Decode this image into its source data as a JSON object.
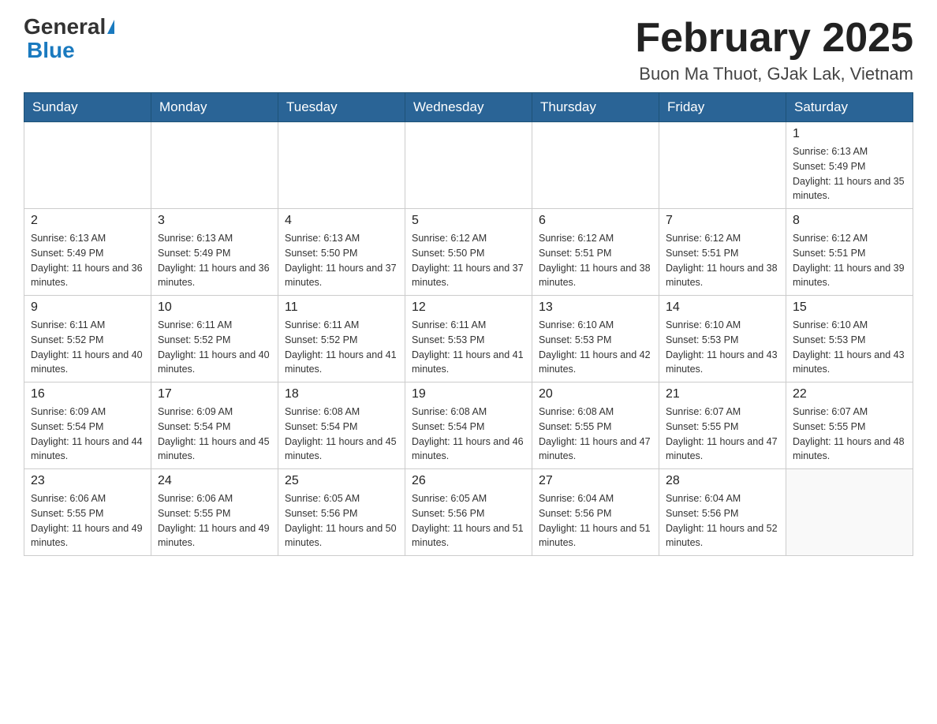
{
  "header": {
    "logo_general": "General",
    "logo_blue": "Blue",
    "month_title": "February 2025",
    "location": "Buon Ma Thuot, GJak Lak, Vietnam"
  },
  "weekdays": [
    "Sunday",
    "Monday",
    "Tuesday",
    "Wednesday",
    "Thursday",
    "Friday",
    "Saturday"
  ],
  "weeks": [
    {
      "days": [
        {
          "number": "",
          "info": ""
        },
        {
          "number": "",
          "info": ""
        },
        {
          "number": "",
          "info": ""
        },
        {
          "number": "",
          "info": ""
        },
        {
          "number": "",
          "info": ""
        },
        {
          "number": "",
          "info": ""
        },
        {
          "number": "1",
          "info": "Sunrise: 6:13 AM\nSunset: 5:49 PM\nDaylight: 11 hours and 35 minutes."
        }
      ]
    },
    {
      "days": [
        {
          "number": "2",
          "info": "Sunrise: 6:13 AM\nSunset: 5:49 PM\nDaylight: 11 hours and 36 minutes."
        },
        {
          "number": "3",
          "info": "Sunrise: 6:13 AM\nSunset: 5:49 PM\nDaylight: 11 hours and 36 minutes."
        },
        {
          "number": "4",
          "info": "Sunrise: 6:13 AM\nSunset: 5:50 PM\nDaylight: 11 hours and 37 minutes."
        },
        {
          "number": "5",
          "info": "Sunrise: 6:12 AM\nSunset: 5:50 PM\nDaylight: 11 hours and 37 minutes."
        },
        {
          "number": "6",
          "info": "Sunrise: 6:12 AM\nSunset: 5:51 PM\nDaylight: 11 hours and 38 minutes."
        },
        {
          "number": "7",
          "info": "Sunrise: 6:12 AM\nSunset: 5:51 PM\nDaylight: 11 hours and 38 minutes."
        },
        {
          "number": "8",
          "info": "Sunrise: 6:12 AM\nSunset: 5:51 PM\nDaylight: 11 hours and 39 minutes."
        }
      ]
    },
    {
      "days": [
        {
          "number": "9",
          "info": "Sunrise: 6:11 AM\nSunset: 5:52 PM\nDaylight: 11 hours and 40 minutes."
        },
        {
          "number": "10",
          "info": "Sunrise: 6:11 AM\nSunset: 5:52 PM\nDaylight: 11 hours and 40 minutes."
        },
        {
          "number": "11",
          "info": "Sunrise: 6:11 AM\nSunset: 5:52 PM\nDaylight: 11 hours and 41 minutes."
        },
        {
          "number": "12",
          "info": "Sunrise: 6:11 AM\nSunset: 5:53 PM\nDaylight: 11 hours and 41 minutes."
        },
        {
          "number": "13",
          "info": "Sunrise: 6:10 AM\nSunset: 5:53 PM\nDaylight: 11 hours and 42 minutes."
        },
        {
          "number": "14",
          "info": "Sunrise: 6:10 AM\nSunset: 5:53 PM\nDaylight: 11 hours and 43 minutes."
        },
        {
          "number": "15",
          "info": "Sunrise: 6:10 AM\nSunset: 5:53 PM\nDaylight: 11 hours and 43 minutes."
        }
      ]
    },
    {
      "days": [
        {
          "number": "16",
          "info": "Sunrise: 6:09 AM\nSunset: 5:54 PM\nDaylight: 11 hours and 44 minutes."
        },
        {
          "number": "17",
          "info": "Sunrise: 6:09 AM\nSunset: 5:54 PM\nDaylight: 11 hours and 45 minutes."
        },
        {
          "number": "18",
          "info": "Sunrise: 6:08 AM\nSunset: 5:54 PM\nDaylight: 11 hours and 45 minutes."
        },
        {
          "number": "19",
          "info": "Sunrise: 6:08 AM\nSunset: 5:54 PM\nDaylight: 11 hours and 46 minutes."
        },
        {
          "number": "20",
          "info": "Sunrise: 6:08 AM\nSunset: 5:55 PM\nDaylight: 11 hours and 47 minutes."
        },
        {
          "number": "21",
          "info": "Sunrise: 6:07 AM\nSunset: 5:55 PM\nDaylight: 11 hours and 47 minutes."
        },
        {
          "number": "22",
          "info": "Sunrise: 6:07 AM\nSunset: 5:55 PM\nDaylight: 11 hours and 48 minutes."
        }
      ]
    },
    {
      "days": [
        {
          "number": "23",
          "info": "Sunrise: 6:06 AM\nSunset: 5:55 PM\nDaylight: 11 hours and 49 minutes."
        },
        {
          "number": "24",
          "info": "Sunrise: 6:06 AM\nSunset: 5:55 PM\nDaylight: 11 hours and 49 minutes."
        },
        {
          "number": "25",
          "info": "Sunrise: 6:05 AM\nSunset: 5:56 PM\nDaylight: 11 hours and 50 minutes."
        },
        {
          "number": "26",
          "info": "Sunrise: 6:05 AM\nSunset: 5:56 PM\nDaylight: 11 hours and 51 minutes."
        },
        {
          "number": "27",
          "info": "Sunrise: 6:04 AM\nSunset: 5:56 PM\nDaylight: 11 hours and 51 minutes."
        },
        {
          "number": "28",
          "info": "Sunrise: 6:04 AM\nSunset: 5:56 PM\nDaylight: 11 hours and 52 minutes."
        },
        {
          "number": "",
          "info": ""
        }
      ]
    }
  ]
}
